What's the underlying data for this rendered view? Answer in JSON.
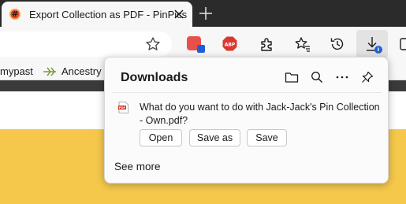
{
  "tab": {
    "favicon_glyph": "#",
    "title": "Export Collection as PDF - PinPics"
  },
  "toolbar": {
    "icons": [
      "star-icon",
      "pinterest-extension-icon",
      "abp-icon",
      "extensions-puzzle-icon",
      "favorites-icon",
      "history-icon",
      "downloads-icon"
    ],
    "abp_label": "ABP"
  },
  "bookmarks": {
    "items": [
      {
        "label": "mypast"
      },
      {
        "label": "Ancestry"
      }
    ]
  },
  "downloads": {
    "title": "Downloads",
    "message": "What do you want to do with Jack-Jack's Pin Collection - Own.pdf?",
    "file_icon_label": "PDF",
    "buttons": {
      "open": "Open",
      "save_as": "Save as",
      "save": "Save"
    },
    "see_more": "See more"
  },
  "colors": {
    "tabstrip": "#2b2b2b",
    "toolbar": "#f7f7f7",
    "page_yellow": "#f5c84c",
    "accent_blue": "#1f5fd6"
  }
}
